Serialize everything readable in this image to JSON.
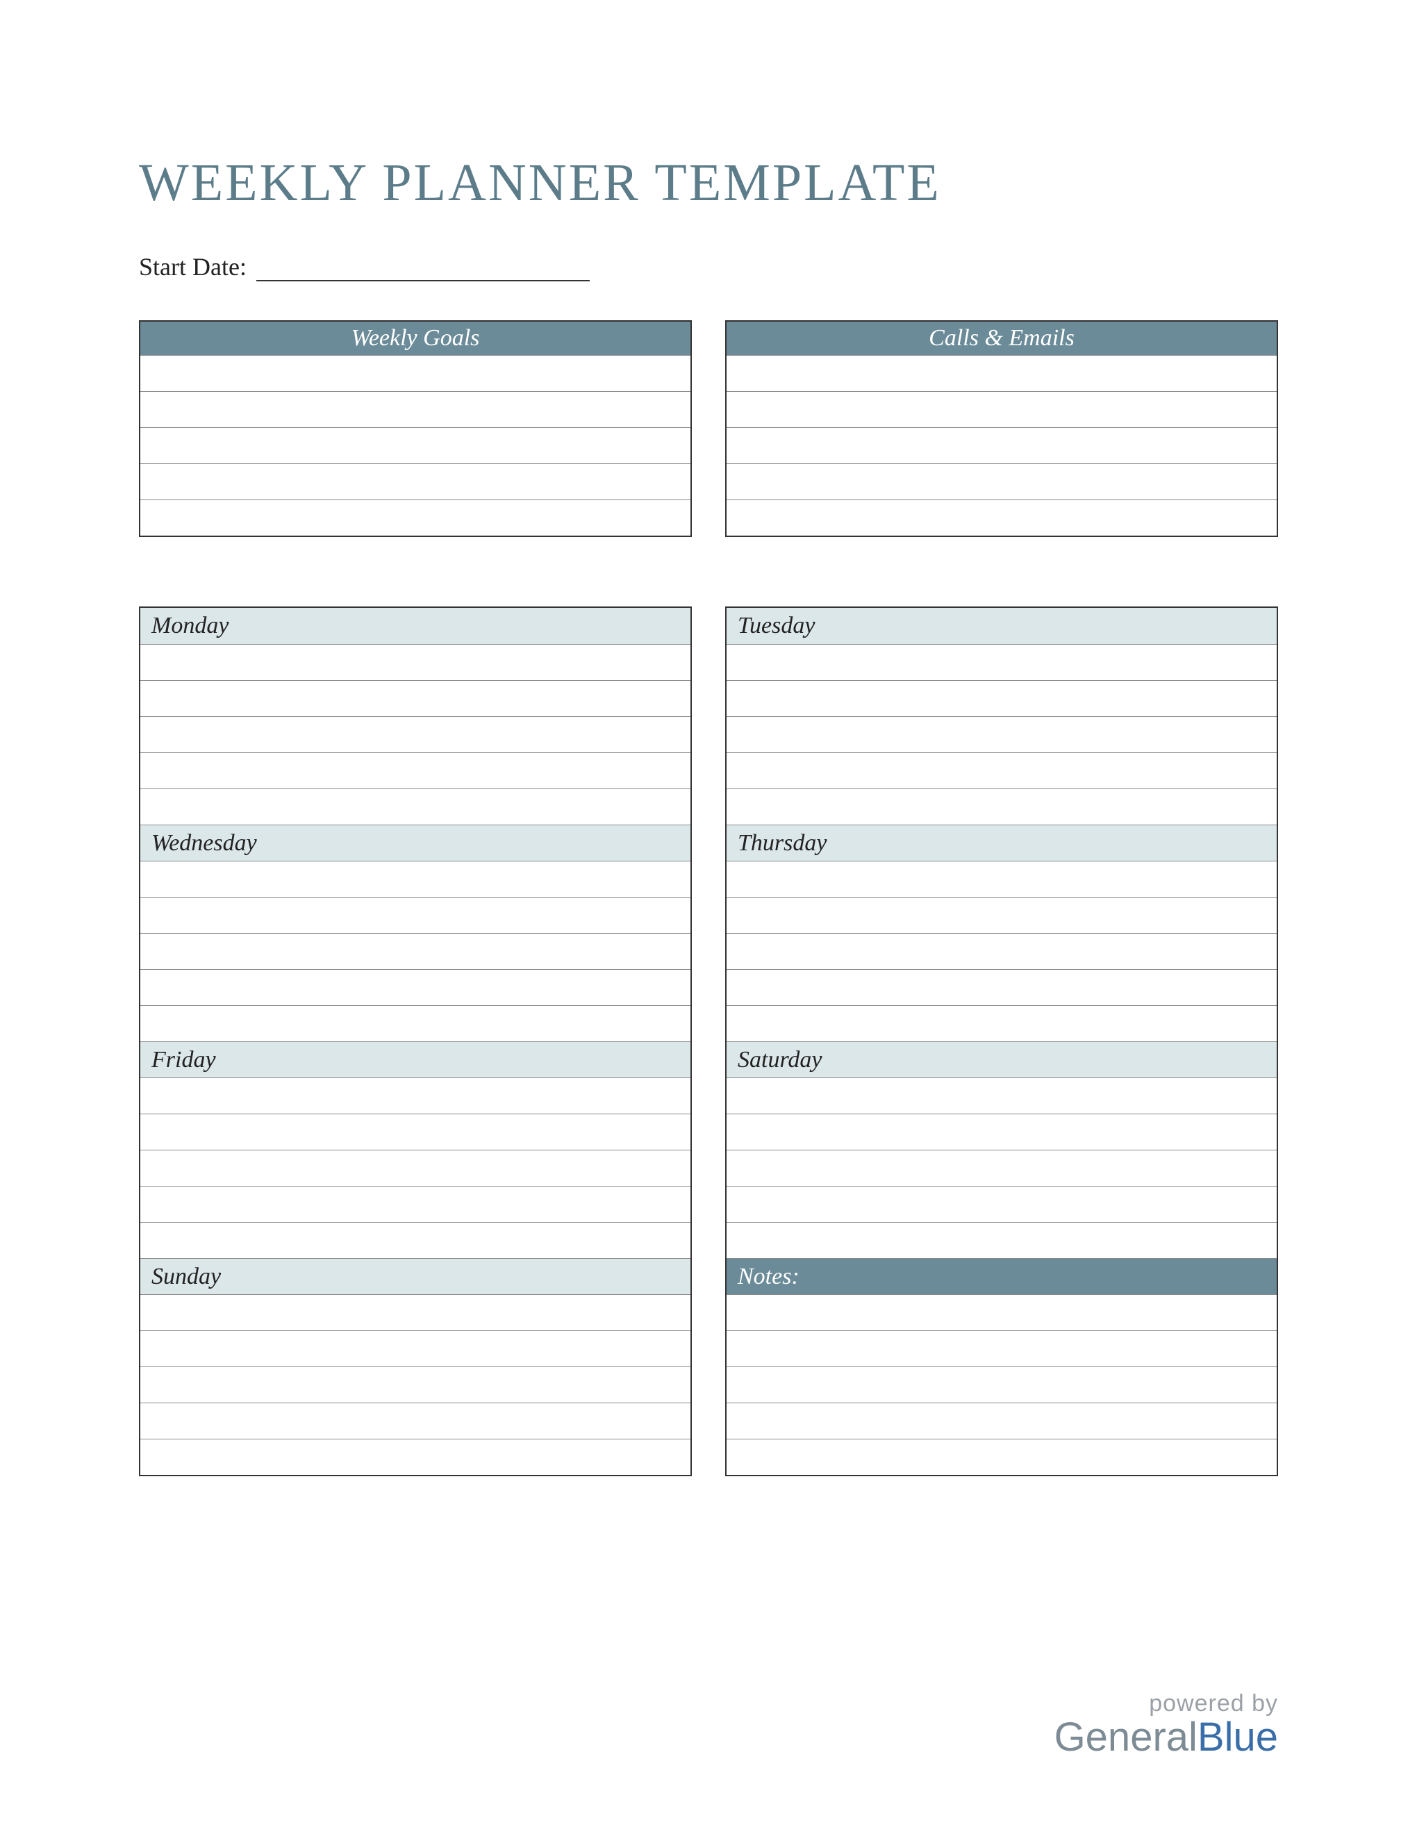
{
  "title": "WEEKLY PLANNER TEMPLATE",
  "start_date_label": "Start Date:",
  "top_sections": {
    "goals": "Weekly Goals",
    "calls": "Calls & Emails"
  },
  "days": {
    "mon": "Monday",
    "tue": "Tuesday",
    "wed": "Wednesday",
    "thu": "Thursday",
    "fri": "Friday",
    "sat": "Saturday",
    "sun": "Sunday"
  },
  "notes_label": "Notes:",
  "footer": {
    "powered": "powered by",
    "brand_general": "General",
    "brand_blue": "Blue"
  },
  "colors": {
    "accent_dark": "#6b8b98",
    "accent_light": "#dce7ea",
    "title": "#5c7c8a"
  }
}
